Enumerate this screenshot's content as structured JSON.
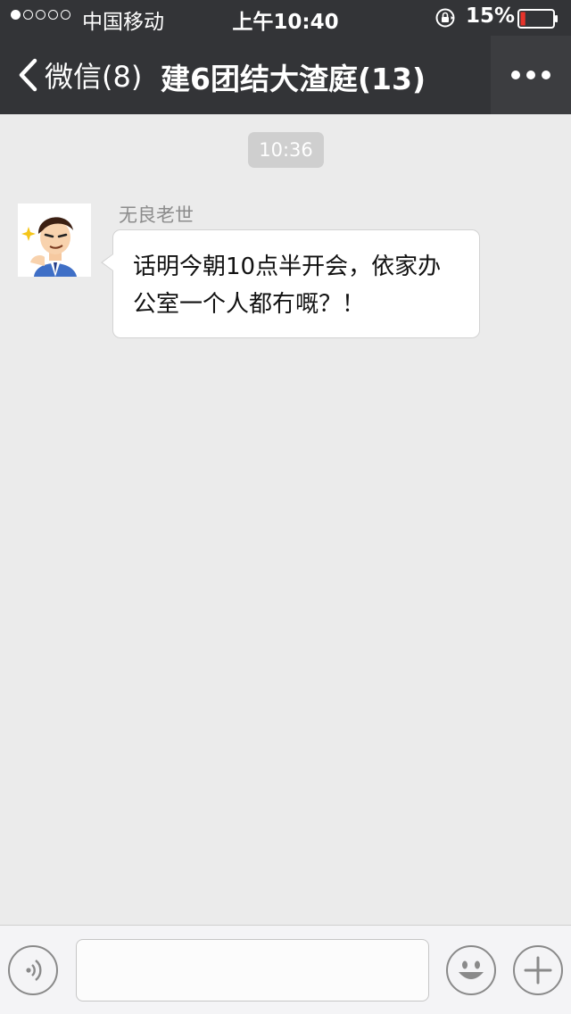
{
  "status_bar": {
    "signal_dots": 5,
    "signal_filled": 1,
    "carrier": "中国移动",
    "time": "上午10:40",
    "battery_percent": "15%",
    "battery_level": 0.15,
    "battery_color": "#e8332a",
    "lock_icon": "rotation-lock-icon"
  },
  "nav": {
    "back_label": "微信(8)",
    "back_icon": "chevron-left-icon",
    "title": "建6团结大渣庭(13)",
    "more_icon": "more-dots-icon"
  },
  "chat": {
    "timestamp": "10:36",
    "messages": [
      {
        "sender": "无良老世",
        "avatar_icon": "cartoon-man-avatar",
        "line1": "话明今朝10点半开会，依家办",
        "line2": "公室一个人都冇嘅？！"
      }
    ]
  },
  "input_bar": {
    "voice_icon": "voice-input-icon",
    "emoji_icon": "emoji-icon",
    "plus_icon": "plus-icon",
    "text_value": ""
  },
  "colors": {
    "topbar": "#333437",
    "background": "#ebebeb",
    "bubble": "#ffffff",
    "input_bar": "#f4f4f6"
  }
}
